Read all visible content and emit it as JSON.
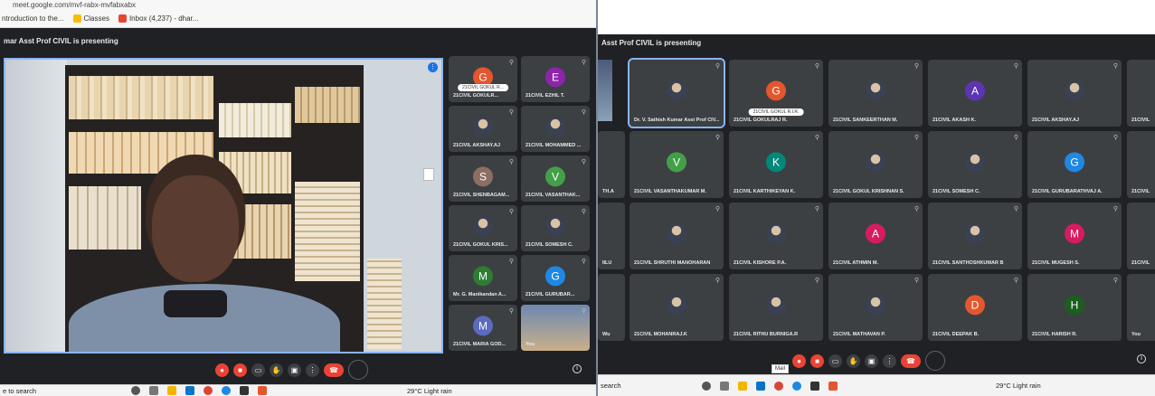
{
  "left": {
    "url_text": "meet.google.com/mvf-rabx-mvfabxabx",
    "bookmarks": [
      "ntroduction to the...",
      "Classes",
      "Inbox (4,237) - dhar..."
    ],
    "presenting": "mar Asst Prof CIVIL is presenting",
    "participants": [
      {
        "name": "21CIVIL GOKULR...",
        "initial": "G",
        "color": "#e4572e",
        "pill": "21CIVIL GOKUL R..."
      },
      {
        "name": "21CIVIL EZHIL T.",
        "initial": "E",
        "color": "#8e24aa"
      },
      {
        "name": "21CIVIL AKSHAY.AJ",
        "photo": true
      },
      {
        "name": "21CIVIL MOHAMMED ...",
        "photo": true
      },
      {
        "name": "21CIVIL SHENBAGAM...",
        "initial": "S",
        "color": "#8d6e63"
      },
      {
        "name": "21CIVIL VASANTHAK...",
        "initial": "V",
        "color": "#43a047"
      },
      {
        "name": "21CIVIL GOKUL KRIS...",
        "photo": true
      },
      {
        "name": "21CIVIL SOMESH C.",
        "photo": true
      },
      {
        "name": "Mr. G. Manikandan A...",
        "initial": "M",
        "color": "#2e7d32"
      },
      {
        "name": "21CIVIL GURUBAR...",
        "initial": "G",
        "color": "#1e88e5"
      },
      {
        "name": "21CIVIL MARIA GOD...",
        "initial": "M",
        "color": "#5c6bc0"
      },
      {
        "name": "You",
        "screen": true
      }
    ],
    "you_label": "You",
    "taskbar_search": "e to search",
    "weather": "29°C Light rain"
  },
  "right": {
    "presenting": "Asst Prof CIVIL is presenting",
    "participants": [
      {
        "name": "Dr. V. Sathish Kumar Asst Prof CIV...",
        "photo": true,
        "active": true
      },
      {
        "name": "21CIVIL GOKULRAJ R.",
        "initial": "G",
        "color": "#e4572e",
        "pill": "21CIVIL GOKUL R.I.R."
      },
      {
        "name": "21CIVIL SANKEERTHAN M.",
        "photo": true
      },
      {
        "name": "21CIVIL AKASH K.",
        "initial": "A",
        "color": "#5e35b1"
      },
      {
        "name": "21CIVIL AKSHAY.AJ",
        "photo": true
      },
      {
        "name": "21CIVIL VASANTHAKUMAR M.",
        "initial": "V",
        "color": "#43a047"
      },
      {
        "name": "21CIVIL KARTHIKEYAN K.",
        "initial": "K",
        "color": "#00897b"
      },
      {
        "name": "21CIVIL GOKUL KRISHNAN S.",
        "photo": true
      },
      {
        "name": "21CIVIL SOMESH C.",
        "photo": true
      },
      {
        "name": "21CIVIL GURUBARATHVAJ A.",
        "initial": "G",
        "color": "#1e88e5"
      },
      {
        "name": "21CIVIL SHRUTHI MANOHARAN",
        "photo": true
      },
      {
        "name": "21CIVIL KISHORE P.A.",
        "photo": true
      },
      {
        "name": "21CIVIL ATHMIN M.",
        "initial": "A",
        "color": "#d81b60"
      },
      {
        "name": "21CIVIL SANTHOSHKUMAR B",
        "photo": true
      },
      {
        "name": "21CIVIL MUGESH S.",
        "initial": "M",
        "color": "#d81b60"
      },
      {
        "name": "21CIVIL MOHANRAJ.K",
        "photo": true
      },
      {
        "name": "21CIVIL RITHU BURNIGA.R",
        "photo": true
      },
      {
        "name": "21CIVIL MATHAVAN P.",
        "photo": true
      },
      {
        "name": "21CIVIL DEEPAK B.",
        "initial": "D",
        "color": "#e4572e"
      },
      {
        "name": "21CIVIL HARISH R.",
        "initial": "H",
        "color": "#1b5e20"
      }
    ],
    "edge_names": [
      "TH.A",
      "IILU",
      "Wu"
    ],
    "right_edge_names": [
      "21CIVIL",
      "21CIVIL",
      "21CIVIL"
    ],
    "you_label": "You",
    "taskbar_search": "search",
    "weather": "29°C Light rain",
    "mail_tooltip": "Mail"
  }
}
